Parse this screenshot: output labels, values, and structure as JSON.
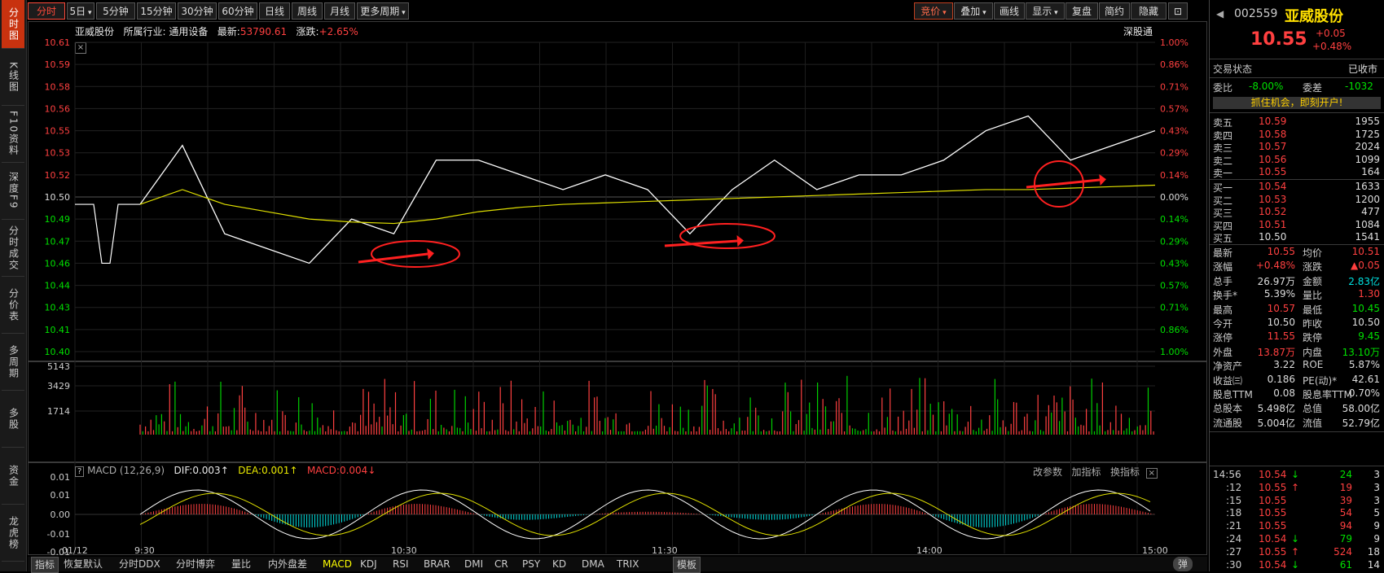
{
  "left_tabs": [
    "分时图",
    "K线图",
    "F10资料",
    "深度F9",
    "分时成交",
    "分价表",
    "多周期",
    "多股",
    "资金",
    "龙虎榜"
  ],
  "toolbar": {
    "left": [
      "分时",
      "5日",
      "5分钟",
      "15分钟",
      "30分钟",
      "60分钟",
      "日线",
      "周线",
      "月线",
      "更多周期"
    ],
    "right": [
      "竞价",
      "叠加",
      "画线",
      "显示",
      "复盘",
      "简约",
      "隐藏"
    ]
  },
  "info": {
    "name": "亚威股份",
    "industry": "所属行业: 通用设备",
    "latest_label": "最新:",
    "latest_value": "53790.61",
    "change_label": "涨跌:",
    "change_value": "+2.65%",
    "exchange": "深股通"
  },
  "price_axis": [
    "10.61",
    "10.59",
    "10.58",
    "10.56",
    "10.55",
    "10.53",
    "10.52",
    "10.50",
    "10.49",
    "10.47",
    "10.46",
    "10.44",
    "10.43",
    "10.41",
    "10.40"
  ],
  "pct_axis": [
    "1.00%",
    "0.86%",
    "0.71%",
    "0.57%",
    "0.43%",
    "0.29%",
    "0.14%",
    "0.00%",
    "0.14%",
    "0.29%",
    "0.43%",
    "0.57%",
    "0.71%",
    "0.86%",
    "1.00%"
  ],
  "vol_axis": [
    "5143",
    "3429",
    "1714"
  ],
  "macd": {
    "label": "MACD (12,26,9)",
    "dif": "DIF:0.003",
    "dea": "DEA:0.001",
    "macd": "MACD:0.004",
    "btns": [
      "改参数",
      "加指标",
      "换指标"
    ],
    "axis": [
      "0.01",
      "0.01",
      "0.00",
      "-0.01",
      "-0.01"
    ]
  },
  "time_axis": [
    "01/12",
    "9:30",
    "10:30",
    "11:30",
    "14:00",
    "15:00"
  ],
  "bottom_tabs": [
    "指标",
    "恢复默认",
    "分时DDX",
    "分时博弈",
    "量比",
    "内外盘差",
    "MACD",
    "KDJ",
    "RSI",
    "BRAR",
    "DMI",
    "CR",
    "PSY",
    "KD",
    "DMA",
    "TRIX",
    "模板"
  ],
  "bottom_right_btn": "弹",
  "quote": {
    "code": "002559",
    "name": "亚威股份",
    "price": "10.55",
    "change": "+0.05",
    "change_pct": "+0.48%",
    "status_label": "交易状态",
    "status_value": "已收市",
    "weibi_label": "委比",
    "weibi_value": "-8.00%",
    "weicha_label": "委差",
    "weicha_value": "-1032",
    "ad_text": "抓住机会，即刻开户!",
    "asks": [
      {
        "label": "卖五",
        "price": "10.59",
        "vol": "1955"
      },
      {
        "label": "卖四",
        "price": "10.58",
        "vol": "1725"
      },
      {
        "label": "卖三",
        "price": "10.57",
        "vol": "2024"
      },
      {
        "label": "卖二",
        "price": "10.56",
        "vol": "1099"
      },
      {
        "label": "卖一",
        "price": "10.55",
        "vol": "164"
      }
    ],
    "bids": [
      {
        "label": "买一",
        "price": "10.54",
        "vol": "1633"
      },
      {
        "label": "买二",
        "price": "10.53",
        "vol": "1200"
      },
      {
        "label": "买三",
        "price": "10.52",
        "vol": "477"
      },
      {
        "label": "买四",
        "price": "10.51",
        "vol": "1084"
      },
      {
        "label": "买五",
        "price": "10.50",
        "vol": "1541"
      }
    ],
    "stats": [
      {
        "l1": "最新",
        "v1": "10.55",
        "c1": "r",
        "l2": "均价",
        "v2": "10.51",
        "c2": "r"
      },
      {
        "l1": "涨幅",
        "v1": "+0.48%",
        "c1": "r",
        "l2": "涨跌",
        "v2": "▲0.05",
        "c2": "r"
      },
      {
        "l1": "总手",
        "v1": "26.97万",
        "c1": "w",
        "l2": "金额",
        "v2": "2.83亿",
        "c2": "c"
      },
      {
        "l1": "换手*",
        "v1": "5.39%",
        "c1": "w",
        "l2": "量比",
        "v2": "1.30",
        "c2": "r"
      },
      {
        "l1": "最高",
        "v1": "10.57",
        "c1": "r",
        "l2": "最低",
        "v2": "10.45",
        "c2": "g"
      },
      {
        "l1": "今开",
        "v1": "10.50",
        "c1": "w",
        "l2": "昨收",
        "v2": "10.50",
        "c2": "w"
      },
      {
        "l1": "涨停",
        "v1": "11.55",
        "c1": "r",
        "l2": "跌停",
        "v2": "9.45",
        "c2": "g"
      },
      {
        "l1": "外盘",
        "v1": "13.87万",
        "c1": "r",
        "l2": "内盘",
        "v2": "13.10万",
        "c2": "g"
      },
      {
        "l1": "净资产",
        "v1": "3.22",
        "c1": "w",
        "l2": "ROE",
        "v2": "5.87%",
        "c2": "w"
      },
      {
        "l1": "收益㈢",
        "v1": "0.186",
        "c1": "w",
        "l2": "PE(动)*",
        "v2": "42.61",
        "c2": "w"
      },
      {
        "l1": "股息TTM",
        "v1": "0.08",
        "c1": "w",
        "l2": "股息率TTM",
        "v2": "0.70%",
        "c2": "w"
      },
      {
        "l1": "总股本",
        "v1": "5.498亿",
        "c1": "w",
        "l2": "总值",
        "v2": "58.00亿",
        "c2": "w"
      },
      {
        "l1": "流通股",
        "v1": "5.004亿",
        "c1": "w",
        "l2": "流值",
        "v2": "52.79亿",
        "c2": "w"
      }
    ],
    "ticks": [
      {
        "time": "14:56",
        "price": "10.54",
        "arrow": "↓",
        "ac": "g",
        "vol": "24",
        "vc": "g",
        "n": "3"
      },
      {
        "time": ":12",
        "price": "10.55",
        "arrow": "↑",
        "ac": "r",
        "vol": "19",
        "vc": "r",
        "n": "3"
      },
      {
        "time": ":15",
        "price": "10.55",
        "arrow": "",
        "ac": "r",
        "vol": "39",
        "vc": "r",
        "n": "3"
      },
      {
        "time": ":18",
        "price": "10.55",
        "arrow": "",
        "ac": "r",
        "vol": "54",
        "vc": "r",
        "n": "5"
      },
      {
        "time": ":21",
        "price": "10.55",
        "arrow": "",
        "ac": "r",
        "vol": "94",
        "vc": "r",
        "n": "9"
      },
      {
        "time": ":24",
        "price": "10.54",
        "arrow": "↓",
        "ac": "g",
        "vol": "79",
        "vc": "g",
        "n": "9"
      },
      {
        "time": ":27",
        "price": "10.55",
        "arrow": "↑",
        "ac": "r",
        "vol": "524",
        "vc": "r",
        "n": "18"
      },
      {
        "time": ":30",
        "price": "10.54",
        "arrow": "↓",
        "ac": "g",
        "vol": "61",
        "vc": "g",
        "n": "14"
      }
    ]
  },
  "chart_data": {
    "type": "line",
    "title": "",
    "prev_close": 10.5,
    "ylim": [
      10.4,
      10.61
    ],
    "x": [
      "09:30",
      "09:40",
      "09:50",
      "10:00",
      "10:10",
      "10:20",
      "10:30",
      "10:40",
      "10:50",
      "11:00",
      "11:10",
      "11:20",
      "11:30",
      "13:10",
      "13:20",
      "13:30",
      "13:40",
      "13:50",
      "14:00",
      "14:10",
      "14:20",
      "14:30",
      "14:40",
      "14:50",
      "15:00"
    ],
    "series": [
      {
        "values": [
          10.5,
          10.54,
          10.48,
          10.47,
          10.46,
          10.49,
          10.48,
          10.53,
          10.53,
          10.52,
          10.51,
          10.52,
          10.51,
          10.48,
          10.51,
          10.53,
          10.51,
          10.52,
          10.52,
          10.53,
          10.55,
          10.56,
          10.53,
          10.54,
          10.55
        ]
      },
      {
        "values": [
          10.5,
          10.51,
          10.5,
          10.495,
          10.49,
          10.488,
          10.487,
          10.49,
          10.495,
          10.498,
          10.5,
          10.501,
          10.502,
          10.503,
          10.504,
          10.505,
          10.506,
          10.507,
          10.508,
          10.509,
          10.51,
          10.51,
          10.511,
          10.512,
          10.513
        ]
      }
    ]
  },
  "annotations": {
    "arrows": 3,
    "circles": 3
  }
}
